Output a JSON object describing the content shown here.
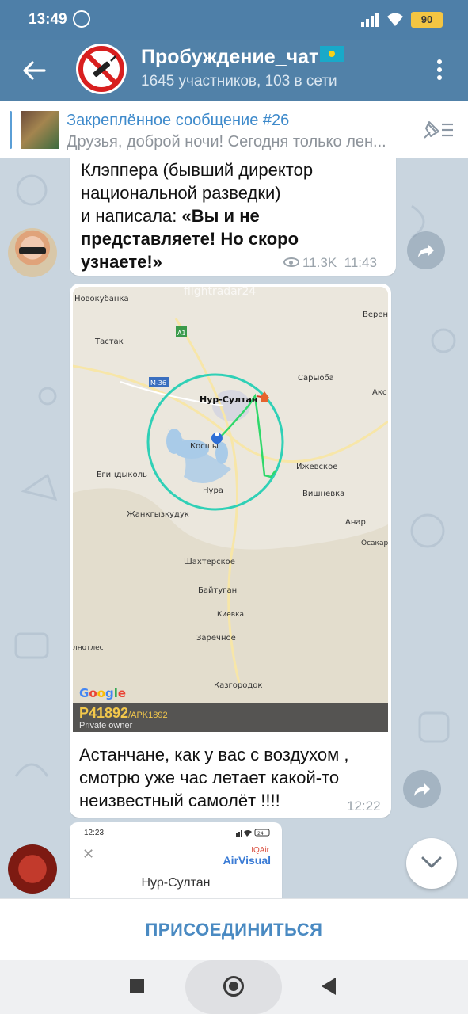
{
  "status_bar": {
    "time": "13:49",
    "battery": "90"
  },
  "header": {
    "title": "Пробуждение_чат",
    "subtitle": "1645 участников, 103 в сети"
  },
  "pinned": {
    "title": "Закреплённое сообщение #26",
    "text": "Друзья, доброй ночи! Сегодня только лен..."
  },
  "messages": [
    {
      "text_line1": "Клэппера (бывший директор",
      "text_line2": "национальной разведки)",
      "text_line3_plain": "и написала: ",
      "text_line3_bold": "«Вы и не",
      "text_bold_rest": "представляете! Но скоро узнаете!»",
      "views": "11.3K",
      "time": "11:43"
    },
    {
      "map": {
        "watermark": "flightradar24",
        "labels": [
          "Новокубанка",
          "Тастак",
          "A1",
          "M-36",
          "Нур-Султан",
          "Косшы",
          "Сарыоба",
          "Акс",
          "Верен",
          "Егиндыколь",
          "Нура",
          "Жанкгызкудук",
          "Ижевское",
          "Вишневка",
          "Анар",
          "Осакар",
          "Шахтерское",
          "Байтуган",
          "Киевка",
          "Заречное",
          "лнотлес",
          "Казгородок"
        ],
        "google": "Google",
        "flight_code": "P41892",
        "flight_alt": "/APK1892",
        "flight_owner": "Private owner"
      },
      "caption": "Астанчане, как у вас с воздухом , смотрю уже час летает какой-то неизвестный самолёт !!!!",
      "time": "12:22"
    },
    {
      "screenshot_time": "12:23",
      "screenshot_battery": "24",
      "brand_top": "IQAir",
      "brand": "AirVisual",
      "city": "Нур-Султан"
    }
  ],
  "join_button": "ПРИСОЕДИНИТЬСЯ",
  "colors": {
    "header_bg": "#5181a8",
    "accent": "#4a8ac2",
    "pinned_title": "#3e8acb"
  }
}
